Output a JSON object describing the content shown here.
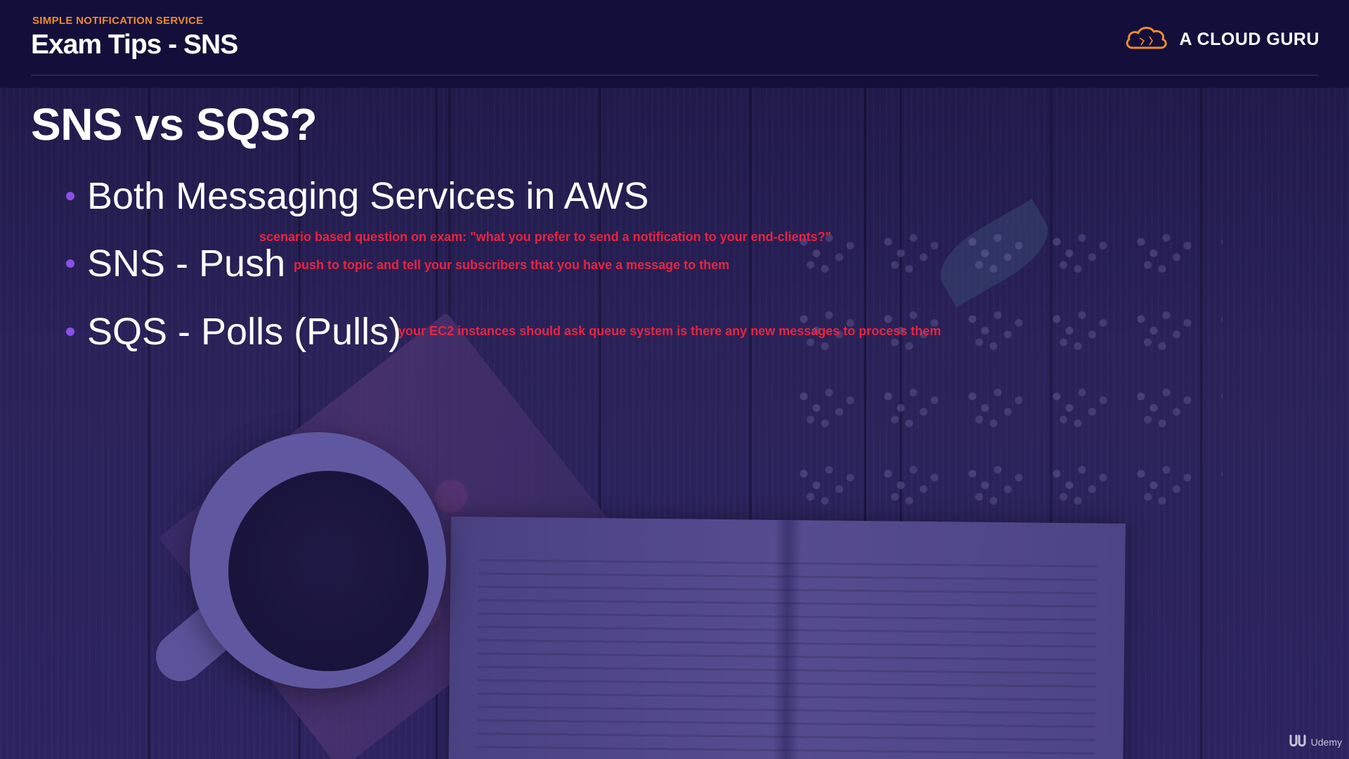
{
  "header": {
    "section_label": "SIMPLE NOTIFICATION SERVICE",
    "title": "Exam Tips - SNS",
    "brand_name": "A CLOUD GURU",
    "brand_icon": "cloud-logo-icon"
  },
  "content": {
    "title": "SNS vs SQS?",
    "bullets": [
      "Both Messaging Services in AWS",
      "SNS - Push",
      "SQS - Polls (Pulls)"
    ],
    "annotations": {
      "scenario": "scenario based question on exam:  \"what you prefer to send a notification to your end-clients?\"",
      "push": "push to topic and tell your subscribers that you have a message to them",
      "polls": "your EC2 instances should ask queue system is there any new messages to process them"
    }
  },
  "watermark": {
    "text": "Udemy",
    "icon": "udemy-logo-icon"
  },
  "colors": {
    "header_bg": "#140f3a",
    "section_label": "#ee8b2c",
    "bullet_dot": "#8a4fe8",
    "annotation": "#e8243f",
    "background": "#241c4e"
  }
}
